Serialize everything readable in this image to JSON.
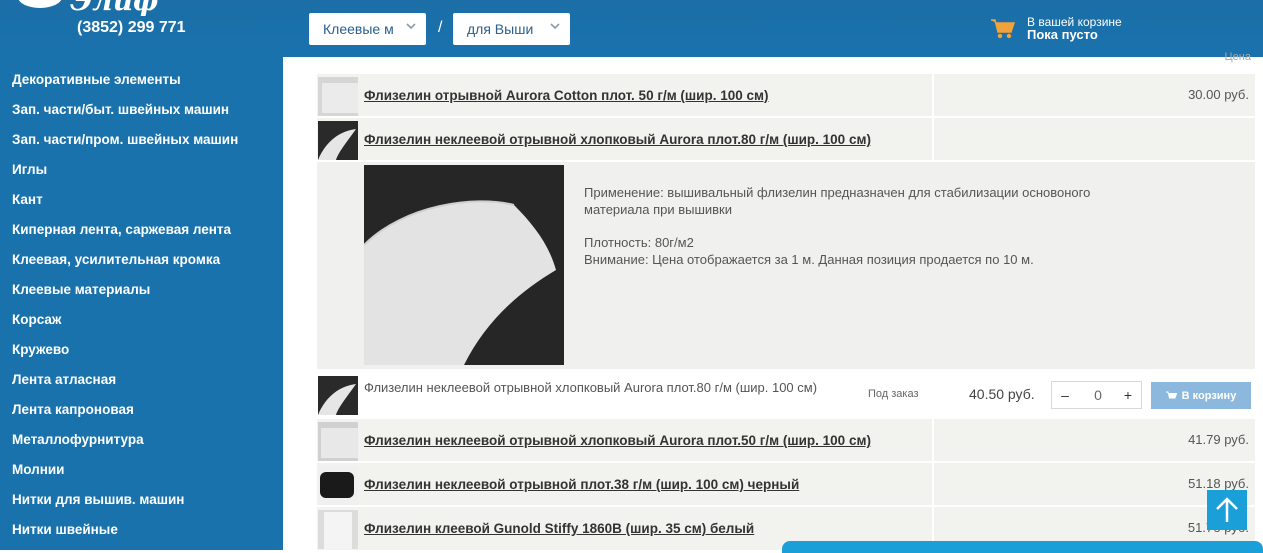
{
  "header": {
    "phone": "(3852) 299 771",
    "select1": "Клеевые м",
    "select2": "для Выши",
    "slash": "/",
    "cart_line1": "В вашей корзине",
    "cart_line2": "Пока пусто"
  },
  "sidebar": {
    "items": [
      {
        "label": "Декоративные элементы"
      },
      {
        "label": "Зап. части/быт. швейных машин"
      },
      {
        "label": "Зап. части/пром. швейных машин"
      },
      {
        "label": "Иглы"
      },
      {
        "label": "Кант"
      },
      {
        "label": "Киперная лента, саржевая лента"
      },
      {
        "label": "Клеевая, усилительная кромка"
      },
      {
        "label": "Клеевые материалы"
      },
      {
        "label": "Корсаж"
      },
      {
        "label": "Кружево"
      },
      {
        "label": "Лента атласная"
      },
      {
        "label": "Лента капроновая"
      },
      {
        "label": "Металлофурнитура"
      },
      {
        "label": "Молнии"
      },
      {
        "label": "Нитки для вышив. машин"
      },
      {
        "label": "Нитки швейные"
      }
    ]
  },
  "table": {
    "price_header": "Цена",
    "rows": [
      {
        "title": "Флизелин отрывной Aurora Cotton плот. 50 г/м (шир. 100 см)",
        "price": "30.00 руб."
      },
      {
        "title": "Флизелин неклеевой отрывной хлопковый Aurora плот.80 г/м (шир. 100 см)",
        "price": ""
      },
      {
        "title": "Флизелин неклеевой отрывной хлопковый Aurora плот.50 г/м (шир. 100 см)",
        "price": "41.79 руб."
      },
      {
        "title": "Флизелин неклеевой отрывной плот.38 г/м (шир. 100 см) черный",
        "price": "51.18 руб."
      },
      {
        "title": "Флизелин клеевой Gunold Stiffy 1860В (шир. 35 см) белый",
        "price": "51.7б руб."
      }
    ]
  },
  "detail": {
    "line1": "Применение: вышивальный флизелин предназначен для стабилизации основоного",
    "line2": "материала при вышивки",
    "line3": "Плотность: 80г/м2",
    "line4": "Внимание: Цена отображается за 1 м. Данная позиция продается по 10 м."
  },
  "buy": {
    "title": "Флизелин неклеевой отрывной хлопковый Aurora плот.80 г/м (шир. 100 см)",
    "status": "Под заказ",
    "price": "40.50 руб.",
    "minus": "–",
    "qty": "0",
    "plus": "+",
    "button": "В корзину"
  },
  "colors": {
    "header_bg": "#1a72ad",
    "accent": "#1a9fd9",
    "row_bg": "#f2f2ef",
    "button_bg": "#8bb8dc",
    "cart_orange": "#f2a23a"
  }
}
